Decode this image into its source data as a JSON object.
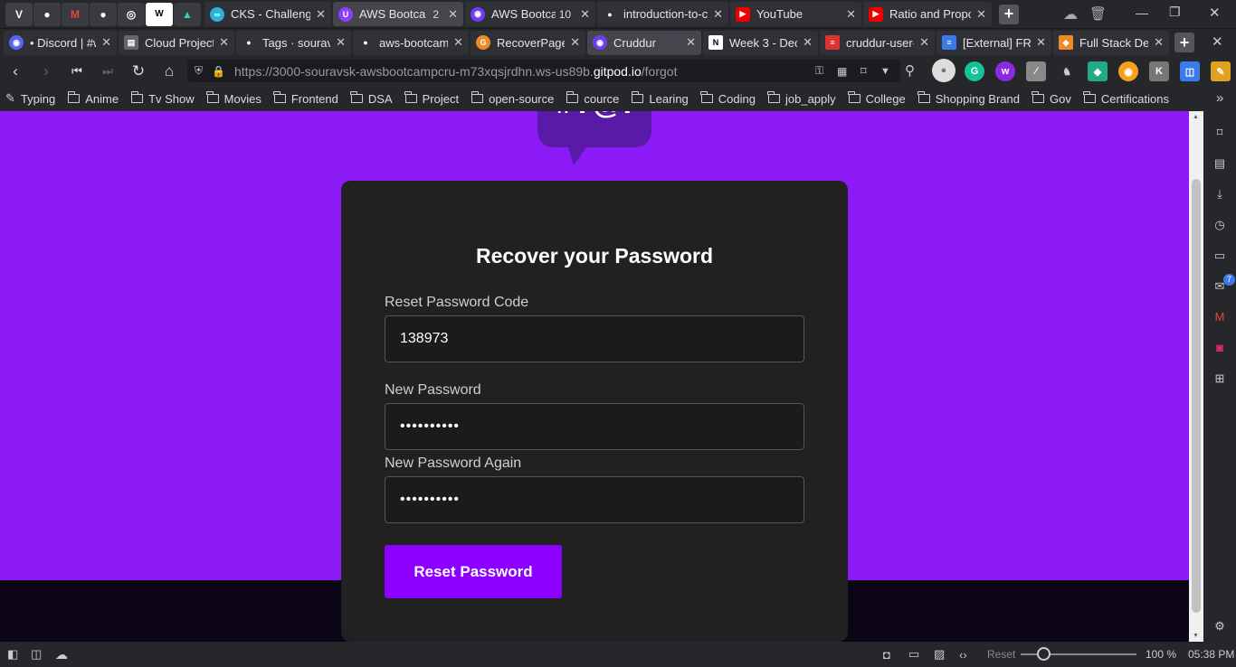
{
  "tabs_row1": {
    "pinned": [
      {
        "name": "vivaldi-icon",
        "glyph": "V"
      },
      {
        "name": "github-icon",
        "glyph": "●"
      },
      {
        "name": "gmail-icon",
        "glyph": "M"
      },
      {
        "name": "github-icon-2",
        "glyph": "●"
      },
      {
        "name": "globe-icon",
        "glyph": "◎"
      },
      {
        "name": "wordle-icon",
        "glyph": "W"
      },
      {
        "name": "vercel-icon",
        "glyph": "▲"
      }
    ],
    "tabs": [
      {
        "label": "CKS - Challenges",
        "count": "",
        "icon_color": "#2bb0e0",
        "glyph": "∞"
      },
      {
        "label": "AWS Bootca",
        "count": "2",
        "icon_color": "#8a3ffc",
        "glyph": "U",
        "active": true
      },
      {
        "label": "AWS Bootca",
        "count": "10",
        "icon_color": "#6f3ef0",
        "glyph": "◉"
      },
      {
        "label": "introduction-to-c",
        "count": "",
        "icon_color": "#222",
        "glyph": "●"
      },
      {
        "label": "YouTube",
        "count": "",
        "icon_color": "#e00",
        "glyph": "▶"
      },
      {
        "label": "Ratio and Propor",
        "count": "",
        "icon_color": "#e00",
        "glyph": "▶"
      }
    ]
  },
  "tabs_row2": [
    {
      "label": "• Discord | #w",
      "icon_color": "#5865f2",
      "glyph": "◉"
    },
    {
      "label": "Cloud Project",
      "icon_color": "#777",
      "glyph": "▤"
    },
    {
      "label": "Tags · souravs",
      "icon_color": "#222",
      "glyph": "●"
    },
    {
      "label": "aws-bootcam",
      "icon_color": "#222",
      "glyph": "●"
    },
    {
      "label": "RecoverPage.j",
      "icon_color": "#f08a24",
      "glyph": "G"
    },
    {
      "label": "Cruddur",
      "icon_color": "#6f3ef0",
      "glyph": "◉",
      "active": true
    },
    {
      "label": "Week 3 - Dec",
      "icon_color": "#fff",
      "glyph": "N"
    },
    {
      "label": "cruddur-user-",
      "icon_color": "#d33",
      "glyph": "≡"
    },
    {
      "label": "[External] FRE",
      "icon_color": "#3b7ae8",
      "glyph": "≡"
    },
    {
      "label": "Full Stack Dev",
      "icon_color": "#f08a24",
      "glyph": "◆"
    }
  ],
  "address": {
    "prefix": "https://3000-souravsk-awsbootcampcru-m73xqsjrdhn.ws-us89b.",
    "host": "gitpod.io",
    "path": "/forgot"
  },
  "bookmarks": [
    "Typing",
    "Anime",
    "Tv Show",
    "Movies",
    "Frontend",
    "DSA",
    "Project",
    "open-source",
    "cource",
    "Learing",
    "Coding",
    "job_apply",
    "College",
    "Shopping Brand",
    "Gov",
    "Certifications"
  ],
  "form": {
    "title": "Recover your Password",
    "code_label": "Reset Password Code",
    "code_value": "138973",
    "password_label": "New Password",
    "password_value": "••••••••••",
    "password_again_label": "New Password Again",
    "password_again_value": "••••••••••",
    "submit_label": "Reset Password"
  },
  "logo_text": "#?@!",
  "status": {
    "reset_label": "Reset",
    "zoom": "100 %",
    "clock": "05:38 PM"
  },
  "side_badge": "7",
  "colors": {
    "page_bg": "#8c1af6",
    "card_bg": "#212121",
    "button_bg": "#8c00ff",
    "footer_bg": "#0c0417"
  }
}
